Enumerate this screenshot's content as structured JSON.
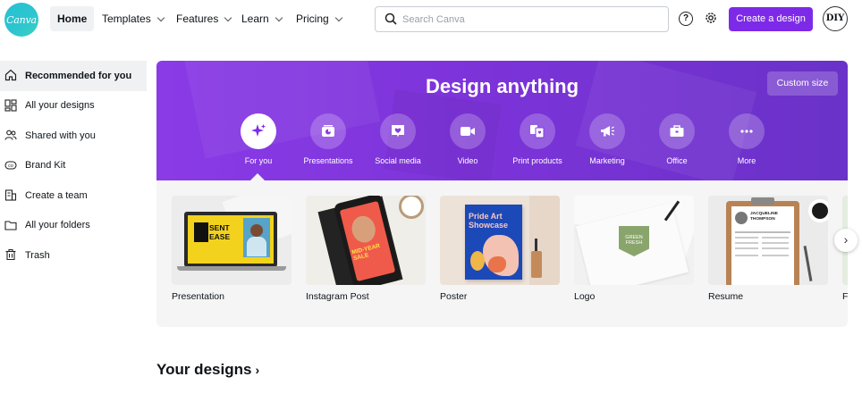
{
  "nav": {
    "logo_text": "Canva",
    "home": "Home",
    "templates": "Templates",
    "features": "Features",
    "learn": "Learn",
    "pricing": "Pricing",
    "search_placeholder": "Search Canva",
    "help": "?",
    "create_button": "Create a design",
    "avatar_text": "DIY",
    "accent": "#7d2ae8"
  },
  "sidebar": {
    "items": [
      {
        "label": "Recommended for you",
        "icon": "home-icon"
      },
      {
        "label": "All your designs",
        "icon": "grid-icon"
      },
      {
        "label": "Shared with you",
        "icon": "people-icon"
      },
      {
        "label": "Brand Kit",
        "icon": "brand-kit-icon"
      },
      {
        "label": "Create a team",
        "icon": "building-icon"
      },
      {
        "label": "All your folders",
        "icon": "folder-icon"
      },
      {
        "label": "Trash",
        "icon": "trash-icon"
      }
    ]
  },
  "hero": {
    "title": "Design anything",
    "custom_size": "Custom size",
    "categories": [
      {
        "label": "For you",
        "icon": "sparkle-icon"
      },
      {
        "label": "Presentations",
        "icon": "presentation-icon"
      },
      {
        "label": "Social media",
        "icon": "heart-icon"
      },
      {
        "label": "Video",
        "icon": "video-camera-icon"
      },
      {
        "label": "Print products",
        "icon": "print-icon"
      },
      {
        "label": "Marketing",
        "icon": "megaphone-icon"
      },
      {
        "label": "Office",
        "icon": "briefcase-icon"
      },
      {
        "label": "More",
        "icon": "more-dots-icon"
      }
    ]
  },
  "cards": [
    {
      "label": "Presentation",
      "thumb_text": "SENT EASE"
    },
    {
      "label": "Instagram Post",
      "thumb_text": "MID-YEAR SALE"
    },
    {
      "label": "Poster",
      "thumb_text": "Pride Art Showcase"
    },
    {
      "label": "Logo",
      "thumb_text": "GREEN FRESH"
    },
    {
      "label": "Resume",
      "thumb_text": "JACQUELINE THOMPSON"
    },
    {
      "label": "F"
    }
  ],
  "next_label": "›",
  "your_designs": {
    "title": "Your designs",
    "arrow": "›"
  }
}
